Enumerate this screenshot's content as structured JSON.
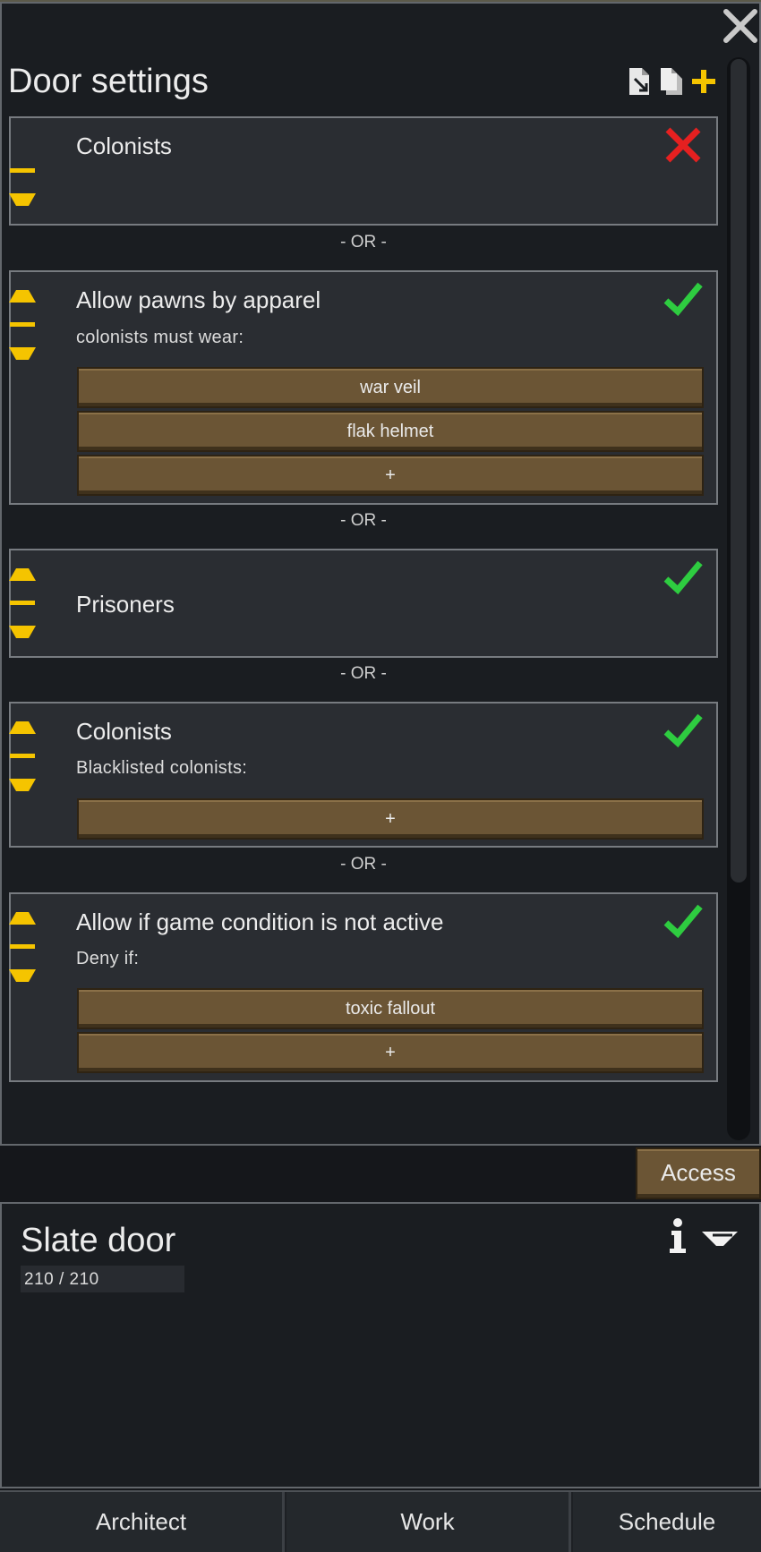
{
  "dialog": {
    "title": "Door settings",
    "or_label": "- OR -",
    "rules": [
      {
        "title": "Colonists",
        "subtitle": "",
        "status": "deny",
        "items": []
      },
      {
        "title": "Allow pawns by apparel",
        "subtitle": "colonists must wear:",
        "status": "allow",
        "items": [
          "war veil",
          "flak helmet",
          "+"
        ]
      },
      {
        "title": "Prisoners",
        "subtitle": "",
        "status": "allow",
        "items": []
      },
      {
        "title": "Colonists",
        "subtitle": "Blacklisted colonists:",
        "status": "allow",
        "items": [
          "+"
        ]
      },
      {
        "title": "Allow if game condition is not active",
        "subtitle": "Deny if:",
        "status": "allow",
        "items": [
          "toxic fallout",
          "+"
        ]
      }
    ]
  },
  "access_button": "Access",
  "inspect": {
    "title": "Slate door",
    "hitpoints": "210 / 210"
  },
  "tabs": [
    "Architect",
    "Work",
    "Schedule"
  ],
  "colors": {
    "accent": "#f5c400",
    "allow": "#2ecc40",
    "deny": "#e62020",
    "button": "#6b5535"
  },
  "icons": [
    "close-icon",
    "paste-icon",
    "copy-icon",
    "add-icon",
    "move-up-icon",
    "drag-handle-icon",
    "move-down-icon",
    "check-icon",
    "cross-icon",
    "info-icon",
    "select-next-icon"
  ]
}
